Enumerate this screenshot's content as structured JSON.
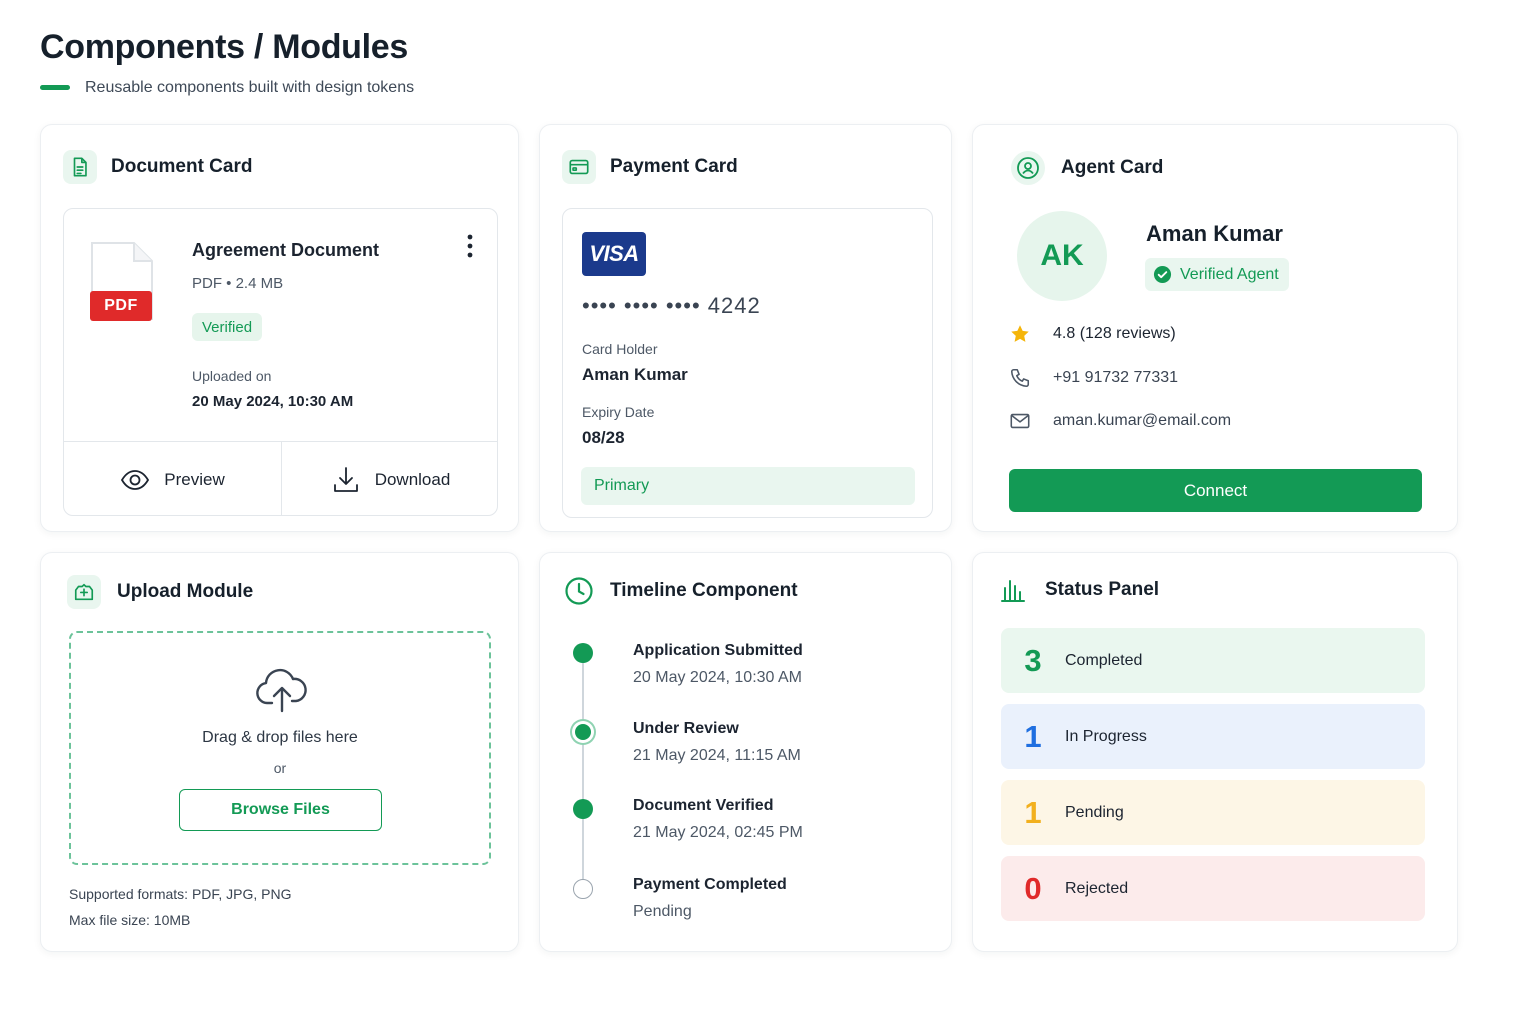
{
  "page": {
    "title": "Components / Modules",
    "subtitle": "Reusable components built with design tokens"
  },
  "colors": {
    "brand": "#139a55",
    "pdf": "#e02a2a",
    "visa": "#1b3a8c",
    "star": "#f5b50a",
    "completed": "#139a55",
    "in_progress": "#1f6fe0",
    "pending": "#f2b01e",
    "rejected": "#e02a2a"
  },
  "document_card": {
    "title": "Document Card",
    "icon": "document-icon",
    "file_type_tag": "PDF",
    "name": "Agreement Document",
    "meta": "PDF • 2.4 MB",
    "status": "Verified",
    "uploaded_label": "Uploaded on",
    "uploaded_date": "20 May 2024, 10:30 AM",
    "actions": {
      "preview": "Preview",
      "download": "Download"
    }
  },
  "payment_card": {
    "title": "Payment Card",
    "icon": "credit-card-icon",
    "brand": "VISA",
    "number": "•••• •••• •••• 4242",
    "holder_label": "Card Holder",
    "holder": "Aman Kumar",
    "expiry_label": "Expiry Date",
    "expiry": "08/28",
    "tag": "Primary"
  },
  "agent_card": {
    "title": "Agent Card",
    "icon": "agent-icon",
    "initials": "AK",
    "name": "Aman Kumar",
    "badge": "Verified Agent",
    "rating": "4.8 (128 reviews)",
    "phone": "+91 91732 77331",
    "email": "aman.kumar@email.com",
    "cta": "Connect"
  },
  "upload_module": {
    "title": "Upload Module",
    "icon": "cloud-upload-icon",
    "drop_text": "Drag & drop files here",
    "or_text": "or",
    "browse": "Browse Files",
    "formats": "Supported formats: PDF, JPG, PNG",
    "max_size": "Max file size: 10MB"
  },
  "timeline": {
    "title": "Timeline Component",
    "icon": "clock-icon",
    "items": [
      {
        "title": "Application Submitted",
        "sub": "20 May 2024, 10:30 AM",
        "state": "done"
      },
      {
        "title": "Under Review",
        "sub": "21 May 2024, 11:15 AM",
        "state": "current"
      },
      {
        "title": "Document Verified",
        "sub": "21 May 2024, 02:45 PM",
        "state": "done"
      },
      {
        "title": "Payment Completed",
        "sub": "Pending",
        "state": "todo"
      }
    ]
  },
  "status_panel": {
    "title": "Status Panel",
    "icon": "bar-chart-icon",
    "rows": [
      {
        "count": "3",
        "label": "Completed"
      },
      {
        "count": "1",
        "label": "In Progress"
      },
      {
        "count": "1",
        "label": "Pending"
      },
      {
        "count": "0",
        "label": "Rejected"
      }
    ]
  }
}
